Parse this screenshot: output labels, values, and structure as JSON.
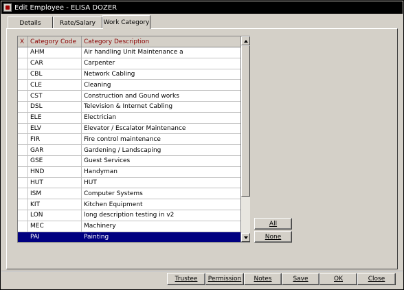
{
  "window": {
    "title": "Edit Employee - ELISA DOZER"
  },
  "tabs": [
    {
      "label": "Details"
    },
    {
      "label": "Rate/Salary"
    },
    {
      "label": "Work Category",
      "active": true
    }
  ],
  "grid": {
    "columns": {
      "x": "X",
      "code": "Category Code",
      "description": "Category Description"
    },
    "rows": [
      {
        "code": "AHM",
        "description": "Air handling Unit Maintenance a"
      },
      {
        "code": "CAR",
        "description": "Carpenter"
      },
      {
        "code": "CBL",
        "description": "Network Cabling"
      },
      {
        "code": "CLE",
        "description": "Cleaning"
      },
      {
        "code": "CST",
        "description": "Construction and Gound works"
      },
      {
        "code": "DSL",
        "description": "Television & Internet Cabling"
      },
      {
        "code": "ELE",
        "description": "Electrician"
      },
      {
        "code": "ELV",
        "description": "Elevator / Escalator Maintenance"
      },
      {
        "code": "FIR",
        "description": "Fire control maintenance"
      },
      {
        "code": "GAR",
        "description": "Gardening / Landscaping"
      },
      {
        "code": "GSE",
        "description": "Guest Services"
      },
      {
        "code": "HND",
        "description": "Handyman"
      },
      {
        "code": "HUT",
        "description": "HUT"
      },
      {
        "code": "ISM",
        "description": "Computer Systems"
      },
      {
        "code": "KIT",
        "description": "Kitchen Equipment"
      },
      {
        "code": "LON",
        "description": "long description testing in v2"
      },
      {
        "code": "MEC",
        "description": "Machinery"
      },
      {
        "code": "PAI",
        "description": "Painting",
        "selected": true
      }
    ]
  },
  "side_buttons": {
    "all": "All",
    "none": "None"
  },
  "footer_buttons": {
    "trustee": "Trustee",
    "permission": "Permission",
    "notes": "Notes",
    "save": "Save",
    "ok": "OK",
    "close": "Close"
  },
  "colors": {
    "selected_row": "#000080",
    "header_text": "#8b0000",
    "background": "#d4d0c8"
  }
}
